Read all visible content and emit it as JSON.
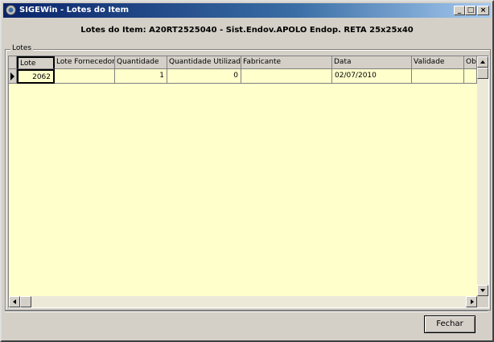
{
  "window": {
    "title": "SIGEWin - Lotes do Item",
    "minimize_label": "_",
    "maximize_label": "□",
    "close_label": "×"
  },
  "header": {
    "text": "Lotes do Item: A20RT2525040 - Sist.Endov.APOLO Endop. RETA 25x25x40"
  },
  "group": {
    "label": "Lotes"
  },
  "grid": {
    "columns": [
      "Lote",
      "Lote Fornecedor",
      "Quantidade",
      "Quantidade Utilizada",
      "Fabricante",
      "Data",
      "Validade",
      "Ob"
    ],
    "rows": [
      [
        "2062",
        "",
        "1",
        "0",
        "",
        "02/07/2010",
        "",
        ""
      ]
    ]
  },
  "footer": {
    "close_button_label": "Fechar"
  }
}
